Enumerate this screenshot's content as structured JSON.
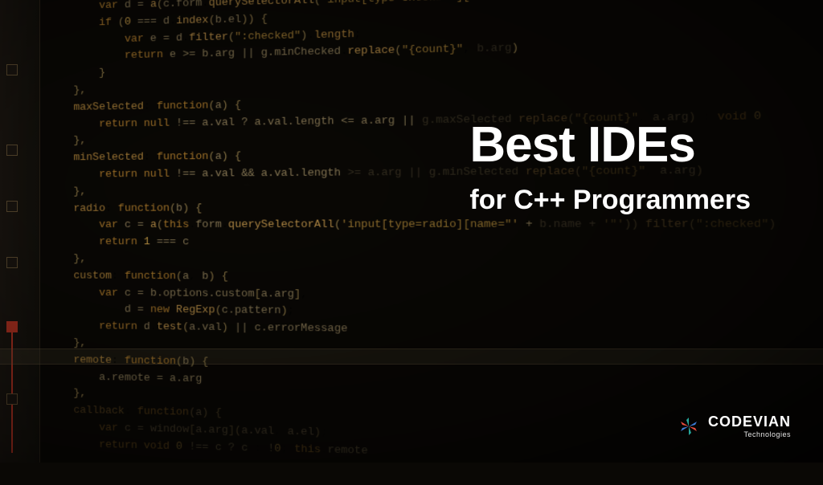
{
  "title": {
    "main": "Best IDEs",
    "sub": "for C++ Programmers"
  },
  "logo": {
    "name": "CODEVIAN",
    "tagline": "Technologies"
  },
  "code": {
    "lines": [
      "var d = a(c.form.querySelectorAll('input[type=checkbox][name=\"' + b.el.name + '\"]');",
      "if (0 === d.index(b.el)) {",
      "    var e = d.filter(\":checked\").length;",
      "    return e >= b.arg || g.minChecked.replace(\"{count}\", b.arg)",
      "}",
      "},",
      "maxSelected: function(a) {",
      "    return null !== a.val ? a.val.length <= a.arg || g.maxSelected.replace(\"{count}\", a.arg) : void 0",
      "},",
      "minSelected: function(a) {",
      "    return null !== a.val && a.val.length >= a.arg || g.minSelected.replace(\"{count}\", a.arg)",
      "},",
      "radio: function(b) {",
      "    var c = a(this.form.querySelectorAll('input[type=radio][name=\"' + b.name + '\"')).filter(\":checked\");",
      "    return 1 === c",
      "},",
      "custom: function(a, b) {",
      "    var c = b.options.custom[a.arg],",
      "        d = new RegExp(c.pattern);",
      "    return d.test(a.val) || c.errorMessage",
      "},",
      "remote: function(b) {",
      "    a.remote = a.arg",
      "},",
      "callback: function(a) {",
      "    var c = window[a.arg](a.val, a.el);",
      "    return void 0 !== c ? c : !0; this.remote"
    ]
  }
}
